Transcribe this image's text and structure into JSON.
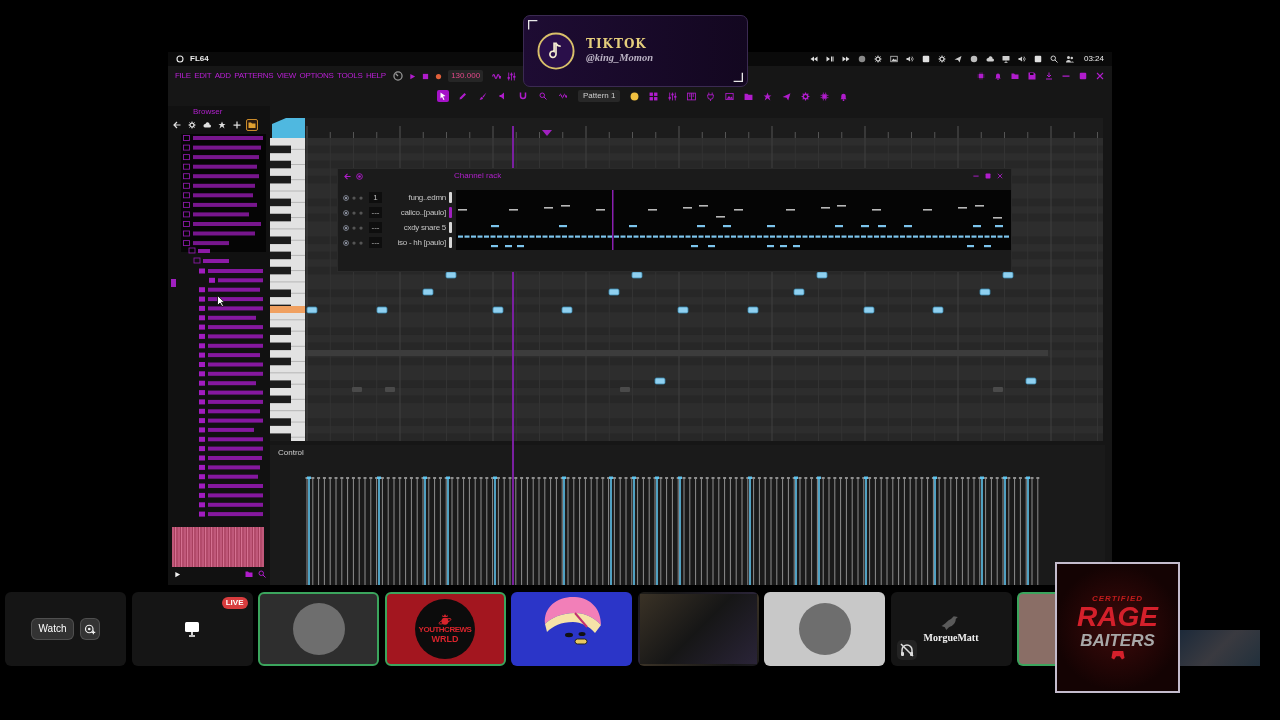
{
  "overlay": {
    "title": "TIKTOK",
    "handle": "@king_Momon"
  },
  "window": {
    "title": "FL64",
    "clock": "03:24"
  },
  "menu": [
    "FILE",
    "EDIT",
    "ADD",
    "PATTERNS",
    "VIEW",
    "OPTIONS",
    "TOOLS",
    "HELP"
  ],
  "toolbar": {
    "tempo": "130.000",
    "tools": [
      {
        "selected": true
      },
      {
        "selected": false
      },
      {
        "selected": false
      },
      {
        "selected": false
      },
      {
        "selected": false
      },
      {
        "selected": false
      },
      {
        "selected": false
      }
    ],
    "pattern": "Pattern 1"
  },
  "browser": {
    "title": "Browser",
    "tabs": [
      {
        "selected": false
      },
      {
        "selected": false
      },
      {
        "selected": false
      },
      {
        "selected": false
      },
      {
        "selected": false
      },
      {
        "selected": true
      }
    ]
  },
  "channel_rack": {
    "title": "Channel rack",
    "channels": [
      {
        "insert": "1",
        "name": "fung..edmn",
        "selected": false
      },
      {
        "insert": "---",
        "name": "calico..[paulo]",
        "selected": true
      },
      {
        "insert": "---",
        "name": "cxdy snare 5",
        "selected": false
      },
      {
        "insert": "---",
        "name": "iso - hh [paulo]",
        "selected": false
      }
    ]
  },
  "editor": {
    "tab": "Control"
  },
  "call_tiles": [
    {
      "kind": "preview",
      "button": "Watch"
    },
    {
      "kind": "screen",
      "badge": "LIVE"
    },
    {
      "kind": "photo",
      "speaking": true,
      "color": "#2e2e2e"
    },
    {
      "kind": "logo",
      "speaking": true,
      "color": "#a3161f",
      "logo_lines": [
        "YOUTHCREWS",
        "WRLD"
      ]
    },
    {
      "kind": "cartoon",
      "speaking": false,
      "color": "#2b35c8"
    },
    {
      "kind": "video"
    },
    {
      "kind": "photo",
      "speaking": false,
      "color": "#c8c8c8"
    },
    {
      "kind": "named",
      "name": "MorgueMatt",
      "muted": true
    },
    {
      "kind": "partial",
      "speaking": true,
      "color": "#8a6e66"
    },
    {
      "kind": "letterbox"
    }
  ],
  "logo_card": {
    "lines": [
      "CERTIFIED",
      "RAGE",
      "BAITERS"
    ]
  }
}
